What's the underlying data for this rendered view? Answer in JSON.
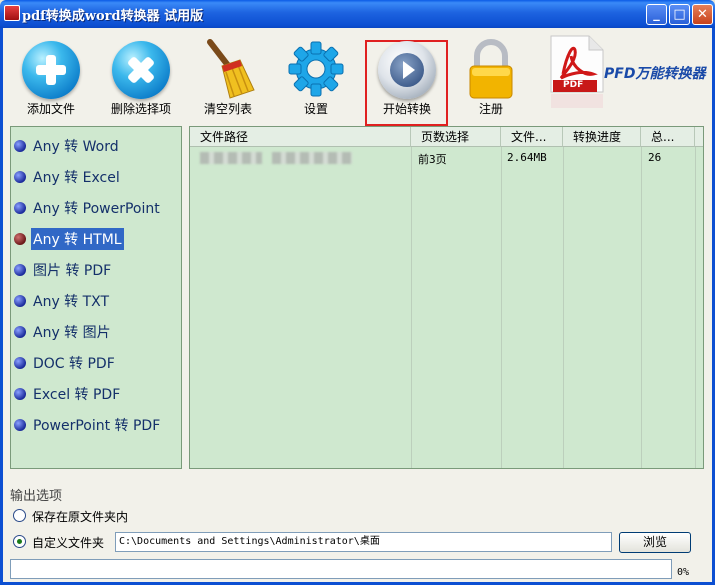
{
  "window": {
    "title": "pdf转换成word转换器 试用版",
    "min_symbol": "_",
    "max_symbol": "□",
    "close_symbol": "✕"
  },
  "toolbar": {
    "add_file": "添加文件",
    "remove_selected": "删除选择项",
    "clear_list": "清空列表",
    "settings": "设置",
    "start_convert": "开始转换",
    "register": "注册",
    "brand": "PFD万能转换器",
    "pdf_badge": "PDF"
  },
  "conversion_types": [
    "Any 转 Word",
    "Any 转 Excel",
    "Any 转 PowerPoint",
    "Any 转 HTML",
    "图片 转 PDF",
    "Any 转 TXT",
    "Any 转 图片",
    "DOC 转 PDF",
    "Excel 转 PDF",
    "PowerPoint 转 PDF"
  ],
  "selected_index": 3,
  "table": {
    "columns": [
      "文件路径",
      "页数选择",
      "文件...",
      "转换进度",
      "总..."
    ],
    "rows": [
      {
        "path": "",
        "pages": "前3页",
        "size": "2.64MB",
        "progress": "",
        "total": "26"
      }
    ]
  },
  "output": {
    "section_title": "输出选项",
    "option_original": "保存在原文件夹内",
    "option_custom": "自定义文件夹",
    "selected_option": "custom",
    "path": "C:\\Documents and Settings\\Administrator\\桌面",
    "browse_label": "浏览"
  },
  "progress": {
    "value": 0,
    "label": "0%"
  },
  "colors": {
    "titlebar": "#0c4fd2",
    "panel_bg": "#cfe8cf",
    "highlight": "#e02020",
    "selection": "#3168c6"
  }
}
